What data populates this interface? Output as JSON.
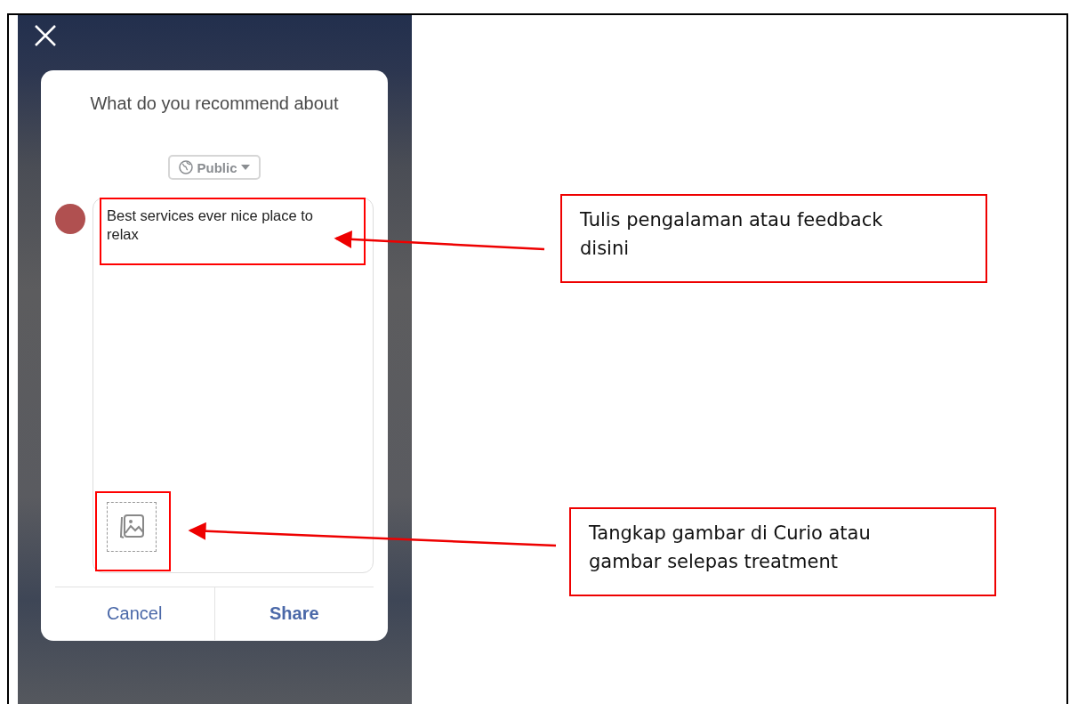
{
  "phone": {
    "prompt": "What do you recommend about",
    "audience": "Public",
    "post_text": "Best services ever nice place to relax",
    "buttons": [
      {
        "label": "Cancel",
        "primary": false
      },
      {
        "label": "Share",
        "primary": true
      }
    ]
  },
  "annotations": [
    {
      "text": "Tulis pengalaman atau feedback disini"
    },
    {
      "text": "Tangkap gambar di Curio atau gambar selepas treatment"
    }
  ]
}
